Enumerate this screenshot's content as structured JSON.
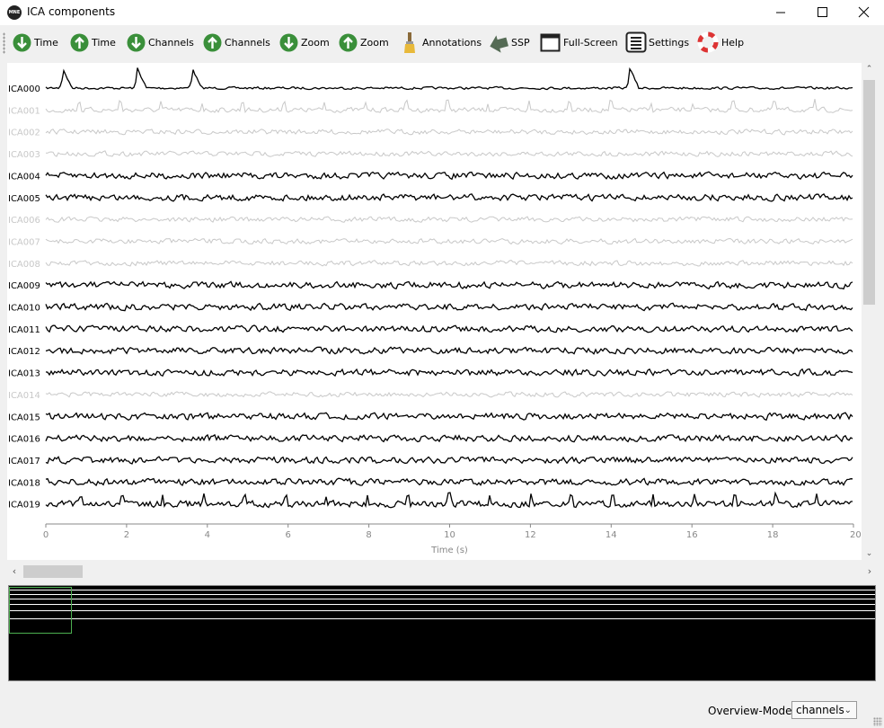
{
  "window": {
    "title": "ICA components",
    "app_icon_text": "MNE"
  },
  "toolbar": {
    "buttons": [
      {
        "label": "Time",
        "icon": "arrow-down-icon"
      },
      {
        "label": "Time",
        "icon": "arrow-up-icon"
      },
      {
        "label": "Channels",
        "icon": "arrow-down-icon"
      },
      {
        "label": "Channels",
        "icon": "arrow-up-icon"
      },
      {
        "label": "Zoom",
        "icon": "arrow-down-icon"
      },
      {
        "label": "Zoom",
        "icon": "arrow-up-icon"
      },
      {
        "label": "Annotations",
        "icon": "brush-icon"
      },
      {
        "label": "SSP",
        "icon": "ssp-icon"
      },
      {
        "label": "Full-Screen",
        "icon": "fullscreen-icon"
      },
      {
        "label": "Settings",
        "icon": "settings-icon"
      },
      {
        "label": "Help",
        "icon": "help-icon"
      }
    ]
  },
  "plot": {
    "xlabel": "Time (s)",
    "xlim": [
      0,
      20
    ],
    "xticks": [
      "0",
      "2",
      "4",
      "6",
      "8",
      "10",
      "12",
      "14",
      "16",
      "18",
      "20"
    ],
    "channels": [
      {
        "name": "ICA000",
        "excluded": false
      },
      {
        "name": "ICA001",
        "excluded": true
      },
      {
        "name": "ICA002",
        "excluded": true
      },
      {
        "name": "ICA003",
        "excluded": true
      },
      {
        "name": "ICA004",
        "excluded": false
      },
      {
        "name": "ICA005",
        "excluded": false
      },
      {
        "name": "ICA006",
        "excluded": true
      },
      {
        "name": "ICA007",
        "excluded": true
      },
      {
        "name": "ICA008",
        "excluded": true
      },
      {
        "name": "ICA009",
        "excluded": false
      },
      {
        "name": "ICA010",
        "excluded": false
      },
      {
        "name": "ICA011",
        "excluded": false
      },
      {
        "name": "ICA012",
        "excluded": false
      },
      {
        "name": "ICA013",
        "excluded": false
      },
      {
        "name": "ICA014",
        "excluded": true
      },
      {
        "name": "ICA015",
        "excluded": false
      },
      {
        "name": "ICA016",
        "excluded": false
      },
      {
        "name": "ICA017",
        "excluded": false
      },
      {
        "name": "ICA018",
        "excluded": false
      },
      {
        "name": "ICA019",
        "excluded": false
      }
    ],
    "colors": {
      "active": "#000000",
      "excluded": "#c8c8c8",
      "axis": "#888888"
    }
  },
  "overview": {
    "mode_label": "Overview-Mode:",
    "mode_value": "channels"
  }
}
